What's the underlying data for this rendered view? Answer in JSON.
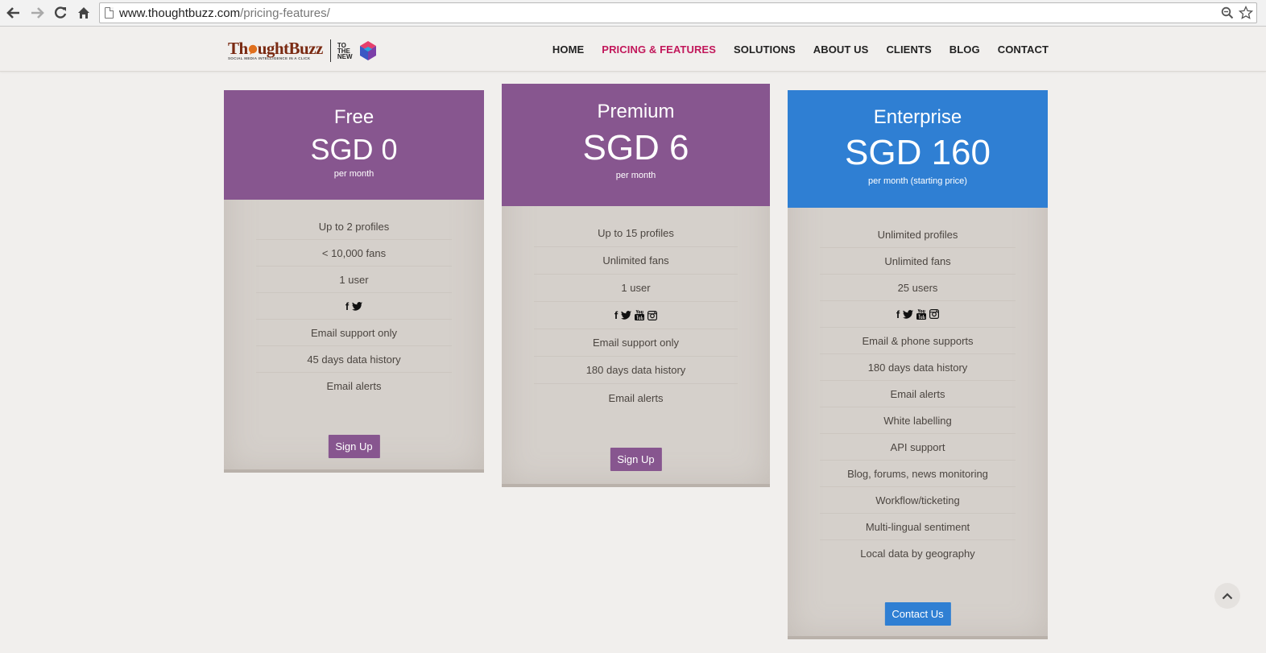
{
  "browser": {
    "url_host": "www.thoughtbuzz.com",
    "url_path": "/pricing-features/"
  },
  "logo": {
    "word_thought": "Th",
    "word_rest": "ughtBuzz",
    "tagline": "SOCIAL MEDIA INTELLIGENCE IN A CLICK",
    "partner": "TO THE NEW"
  },
  "nav": {
    "items": [
      {
        "label": "HOME",
        "active": false
      },
      {
        "label": "PRICING & FEATURES",
        "active": true
      },
      {
        "label": "SOLUTIONS",
        "active": false
      },
      {
        "label": "ABOUT US",
        "active": false
      },
      {
        "label": "CLIENTS",
        "active": false
      },
      {
        "label": "BLOG",
        "active": false
      },
      {
        "label": "CONTACT",
        "active": false
      }
    ]
  },
  "plans": [
    {
      "name": "Free",
      "price": "SGD 0",
      "period": "per month",
      "features": [
        "Up to 2 profiles",
        "< 10,000 fans",
        "1 user",
        "",
        "Email support only",
        "45 days data history",
        "Email alerts"
      ],
      "social_icons": [
        "facebook-icon",
        "twitter-icon"
      ],
      "cta": "Sign Up",
      "color": "#87568f"
    },
    {
      "name": "Premium",
      "price": "SGD 6",
      "period": "per month",
      "features": [
        "Up to 15 profiles",
        "Unlimited fans",
        "1 user",
        "",
        "Email support only",
        "180 days data history",
        "Email alerts"
      ],
      "social_icons": [
        "facebook-icon",
        "twitter-icon",
        "youtube-icon",
        "instagram-icon"
      ],
      "cta": "Sign Up",
      "color": "#87568f"
    },
    {
      "name": "Enterprise",
      "price": "SGD 160",
      "period": "per month (starting price)",
      "features": [
        "Unlimited profiles",
        "Unlimited fans",
        "25 users",
        "",
        "Email & phone supports",
        "180 days data history",
        "Email alerts",
        "White labelling",
        "API support",
        "Blog, forums, news monitoring",
        "Workflow/ticketing",
        "Multi-lingual sentiment",
        "Local data by geography"
      ],
      "social_icons": [
        "facebook-icon",
        "twitter-icon",
        "youtube-icon",
        "instagram-icon"
      ],
      "cta": "Contact Us",
      "color": "#2f7fd3"
    }
  ]
}
